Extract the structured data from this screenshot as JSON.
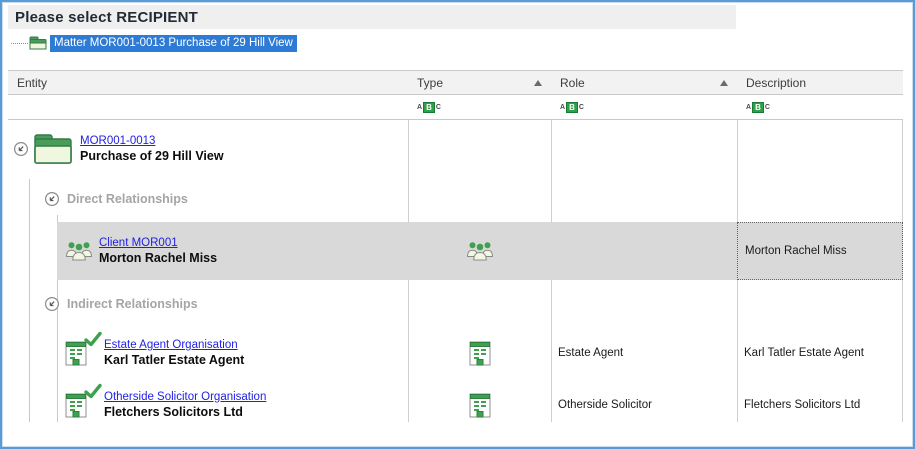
{
  "window": {
    "title": "Please select RECIPIENT"
  },
  "matter_bar": {
    "selected_node": "Matter MOR001-0013 Purchase of 29 Hill View"
  },
  "columns": {
    "entity": {
      "label": "Entity"
    },
    "type": {
      "label": "Type",
      "sort": "asc"
    },
    "role": {
      "label": "Role",
      "sort": "asc"
    },
    "description": {
      "label": "Description"
    }
  },
  "filter_icon": {
    "a": "A",
    "b": "B",
    "c": "C"
  },
  "tree": {
    "matter": {
      "code_link": "MOR001-0013",
      "name": "Purchase of 29 Hill View"
    },
    "direct": {
      "label": "Direct Relationships",
      "client": {
        "link": "Client MOR001",
        "name": "Morton Rachel Miss",
        "role": "",
        "description": "Morton Rachel Miss"
      }
    },
    "indirect": {
      "label": "Indirect Relationships",
      "estate": {
        "link": "Estate Agent Organisation",
        "name": "Karl Tatler Estate Agent",
        "role": "Estate Agent",
        "description": "Karl Tatler Estate Agent"
      },
      "otherside": {
        "link": "Otherside Solicitor Organisation",
        "name": "Fletchers Solicitors Ltd",
        "role": "Otherside Solicitor",
        "description": "Fletchers Solicitors Ltd"
      }
    }
  },
  "colors": {
    "window_border": "#5b9bd5",
    "selection_blue": "#2e7bd6",
    "link_blue": "#2121e6",
    "icon_green": "#3fa04e",
    "selected_row_bg": "#d9d9d9",
    "section_text": "#a5a5a5"
  }
}
